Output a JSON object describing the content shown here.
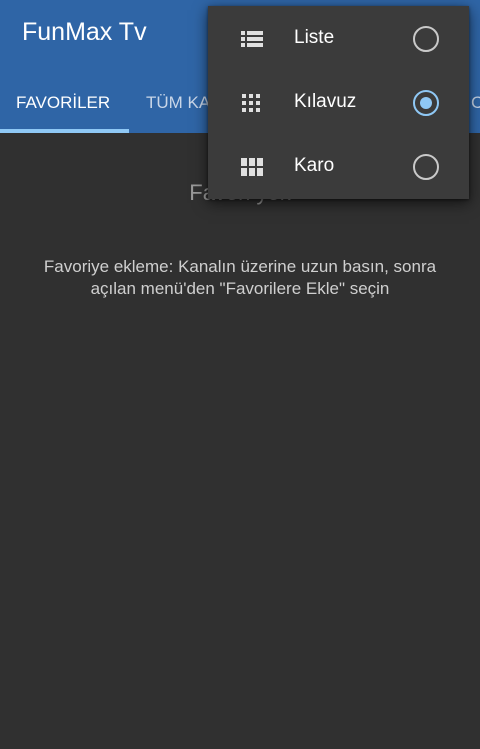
{
  "app": {
    "title": "FunMax Tv"
  },
  "tabs": [
    {
      "label": "FAVORİLER",
      "selected": true
    },
    {
      "label": "TÜM KA",
      "selected": false
    },
    {
      "label": "C",
      "selected": false
    }
  ],
  "content": {
    "title": "Favori yok",
    "hint_line1": "Favoriye ekleme: Kanalın üzerine uzun basın, sonra",
    "hint_line2": "açılan menü'den \"Favorilere Ekle\" seçin"
  },
  "view_menu": {
    "items": [
      {
        "label": "Liste",
        "icon": "list-icon",
        "checked": false
      },
      {
        "label": "Kılavuz",
        "icon": "grid-icon",
        "checked": true
      },
      {
        "label": "Karo",
        "icon": "tile-icon",
        "checked": false
      }
    ]
  },
  "colors": {
    "app_bar": "#2f65a6",
    "background": "#303030",
    "menu_background": "#3b3b3b",
    "accent": "#8fc8f5"
  }
}
